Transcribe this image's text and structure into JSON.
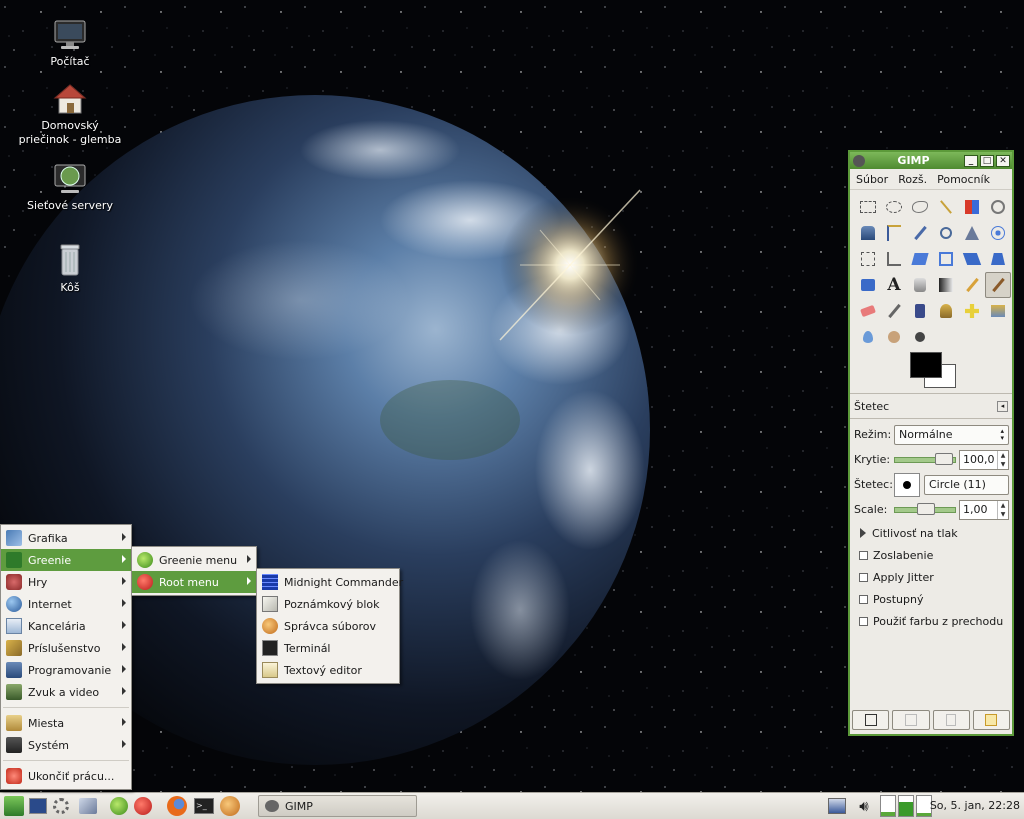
{
  "desktop": {
    "icons": [
      {
        "label": "Počítač"
      },
      {
        "label": "Domovský priečinok - glemba"
      },
      {
        "label": "Sieťové servery"
      },
      {
        "label": "Kôš"
      }
    ]
  },
  "main_menu": {
    "items": [
      {
        "label": "Grafika"
      },
      {
        "label": "Greenie"
      },
      {
        "label": "Hry"
      },
      {
        "label": "Internet"
      },
      {
        "label": "Kancelária"
      },
      {
        "label": "Príslušenstvo"
      },
      {
        "label": "Programovanie"
      },
      {
        "label": "Zvuk a video"
      },
      {
        "label": "Miesta"
      },
      {
        "label": "Systém"
      },
      {
        "label": "Ukončiť prácu..."
      }
    ]
  },
  "greenie_menu": {
    "items": [
      {
        "label": "Greenie menu"
      },
      {
        "label": "Root menu"
      }
    ]
  },
  "root_menu": {
    "items": [
      {
        "label": "Midnight Commander"
      },
      {
        "label": "Poznámkový blok"
      },
      {
        "label": "Správca súborov"
      },
      {
        "label": "Terminál"
      },
      {
        "label": "Textový editor"
      }
    ]
  },
  "gimp": {
    "title": "GIMP",
    "menubar": [
      "Súbor",
      "Rozš.",
      "Pomocník"
    ],
    "tool_options_title": "Štetec",
    "mode_label": "Režim:",
    "mode_value": "Normálne",
    "opacity_label": "Krytie:",
    "opacity_value": "100,0",
    "brush_label": "Štetec:",
    "brush_value": "Circle (11)",
    "scale_label": "Scale:",
    "scale_value": "1,00",
    "pressure_label": "Citlivosť na tlak",
    "checkboxes": [
      "Zoslabenie",
      "Apply Jitter",
      "Postupný",
      "Použiť farbu z prechodu"
    ]
  },
  "taskbar": {
    "task_label": "GIMP",
    "clock": "So, 5. jan, 22:28"
  },
  "colors": {
    "accent_green": "#5e9c3f",
    "window_border": "#5c9a3a"
  }
}
